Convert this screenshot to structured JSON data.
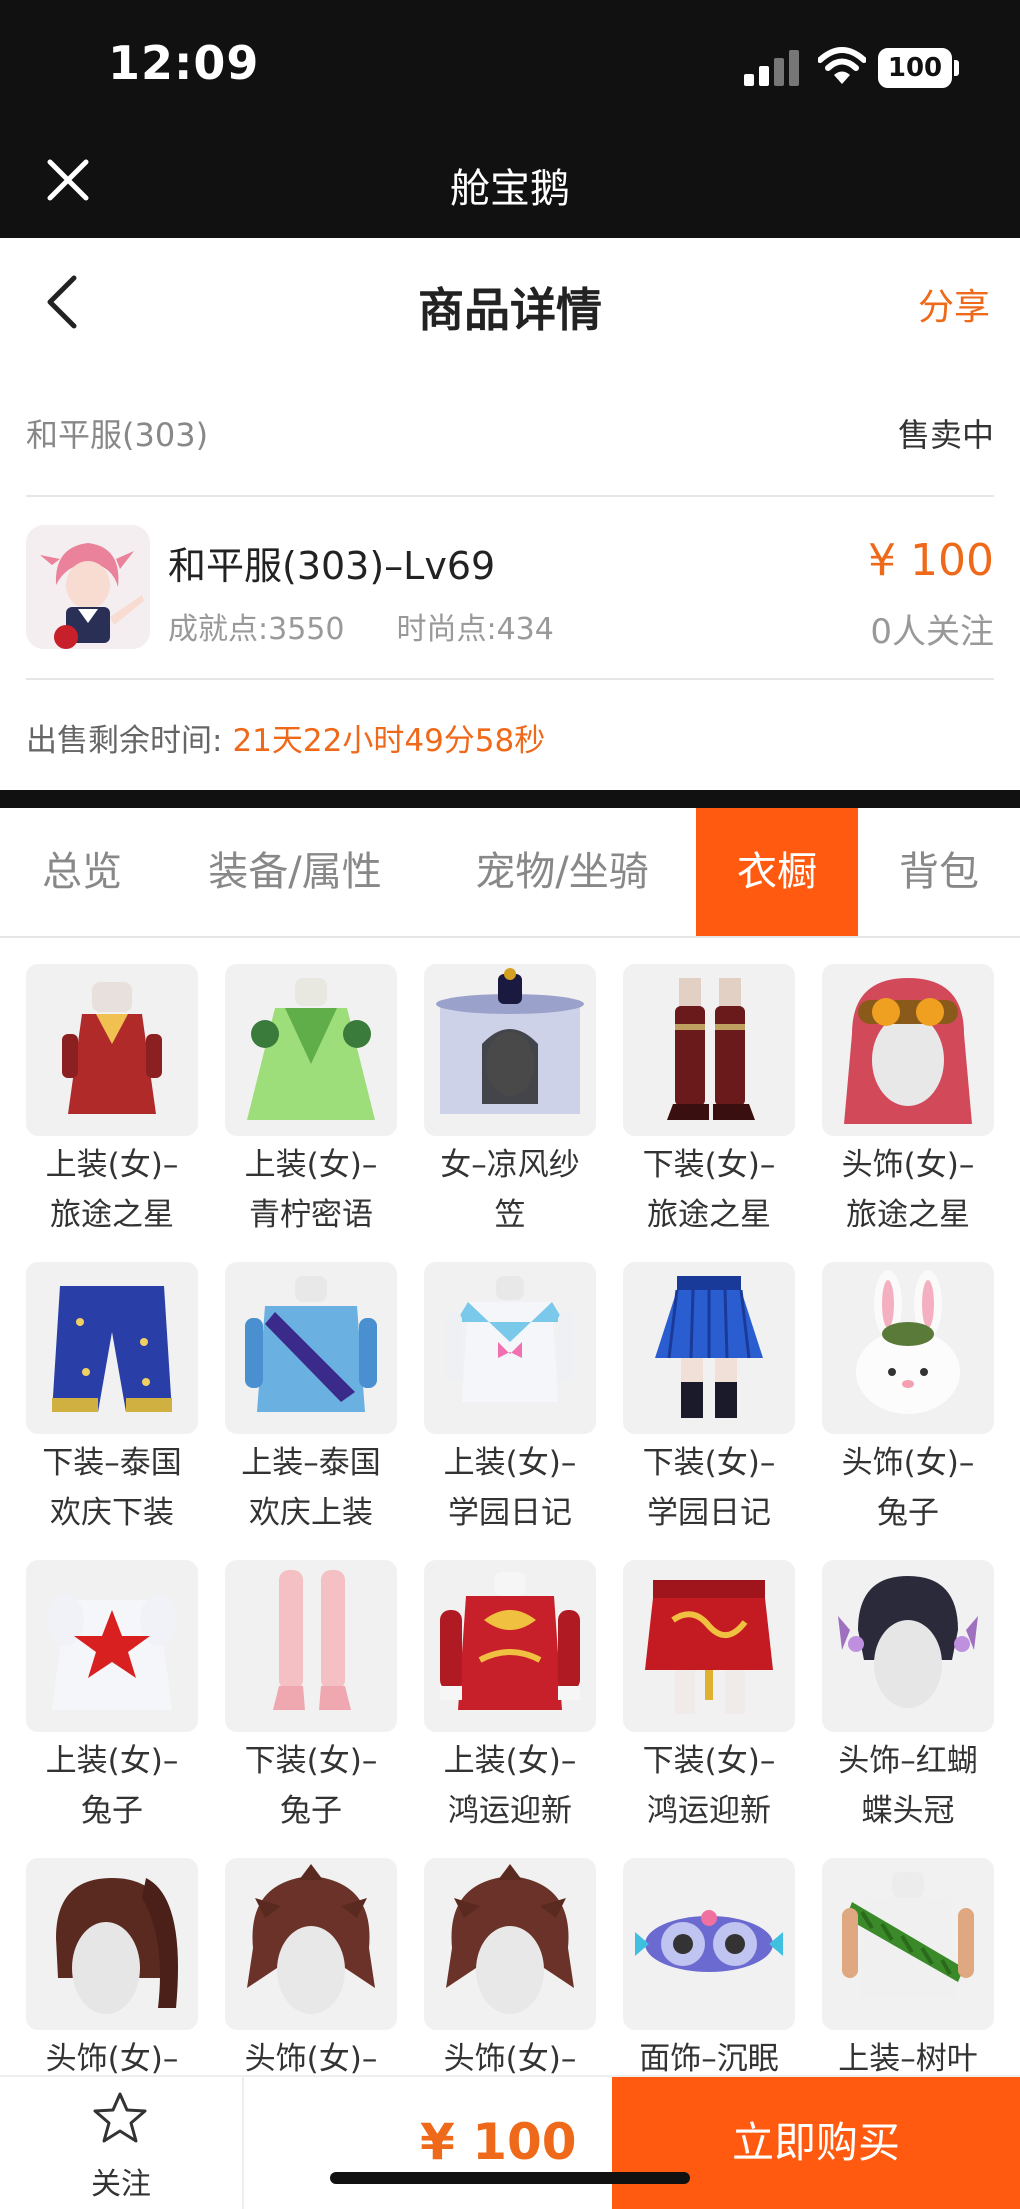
{
  "status_bar": {
    "time": "12:09",
    "battery": "100"
  },
  "app": {
    "title": "舱宝鹅"
  },
  "nav": {
    "title": "商品详情",
    "share": "分享"
  },
  "server": {
    "name": "和平服(303)",
    "status": "售卖中"
  },
  "item": {
    "name": "和平服(303)–Lv69",
    "achievement": "成就点:3550",
    "fashion": "时尚点:434",
    "price": "¥ 100",
    "followers": "0人关注"
  },
  "remaining": {
    "label": "出售剩余时间:",
    "value": "21天22小时49分58秒"
  },
  "tabs": [
    {
      "label": "总览"
    },
    {
      "label": "装备/属性"
    },
    {
      "label": "宠物/坐骑"
    },
    {
      "label": "衣橱",
      "active": true
    },
    {
      "label": "背包"
    }
  ],
  "wardrobe": [
    {
      "line1": "上装(女)–",
      "line2": "旅途之星",
      "icon": "red-dress-icon"
    },
    {
      "line1": "上装(女)–",
      "line2": "青柠密语",
      "icon": "green-gown-icon"
    },
    {
      "line1": "女–凉风纱",
      "line2": "笠",
      "icon": "veil-hat-icon"
    },
    {
      "line1": "下装(女)–",
      "line2": "旅途之星",
      "icon": "boots-icon"
    },
    {
      "line1": "头饰(女)–",
      "line2": "旅途之星",
      "icon": "goggles-hair-icon"
    },
    {
      "line1": "下装–泰国",
      "line2": "欢庆下装",
      "icon": "blue-pants-icon"
    },
    {
      "line1": "上装–泰国",
      "line2": "欢庆上装",
      "icon": "blue-top-icon"
    },
    {
      "line1": "上装(女)–",
      "line2": "学园日记",
      "icon": "sailor-top-icon"
    },
    {
      "line1": "下装(女)–",
      "line2": "学园日记",
      "icon": "pleated-skirt-icon"
    },
    {
      "line1": "头饰(女)–",
      "line2": "兔子",
      "icon": "bunny-hat-icon"
    },
    {
      "line1": "上装(女)–",
      "line2": "兔子",
      "icon": "star-onesie-icon"
    },
    {
      "line1": "下装(女)–",
      "line2": "兔子",
      "icon": "pink-stockings-icon"
    },
    {
      "line1": "上装(女)–",
      "line2": "鸿运迎新",
      "icon": "red-jacket-icon"
    },
    {
      "line1": "下装(女)–",
      "line2": "鸿运迎新",
      "icon": "red-skirt-icon"
    },
    {
      "line1": "头饰–红蝴",
      "line2": "蝶头冠",
      "icon": "butterfly-crown-icon"
    },
    {
      "line1": "头饰(女)–",
      "line2": "",
      "icon": "ponytail-hair-icon"
    },
    {
      "line1": "头饰(女)–",
      "line2": "",
      "icon": "messy-hair-icon"
    },
    {
      "line1": "头饰(女)–",
      "line2": "",
      "icon": "messy-hair-icon"
    },
    {
      "line1": "面饰–沉眠",
      "line2": "",
      "icon": "sleep-mask-icon"
    },
    {
      "line1": "上装–树叶",
      "line2": "",
      "icon": "leaf-top-icon"
    }
  ],
  "footer": {
    "follow": "关注",
    "price": "¥ 100",
    "buy": "立即购买"
  },
  "colors": {
    "accent": "#ff5a10",
    "price": "#ee6a1a",
    "dark": "#111111"
  }
}
